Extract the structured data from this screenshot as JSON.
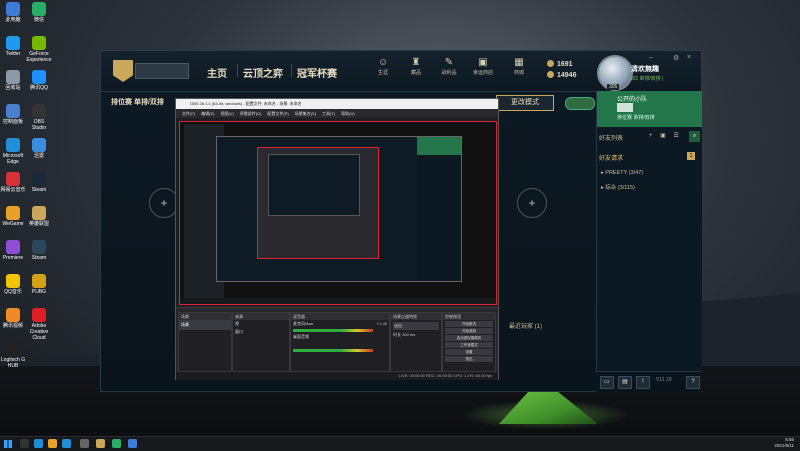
{
  "desktop": {
    "icons": [
      {
        "label": "此电脑",
        "color": "#3b7dd8"
      },
      {
        "label": "微信",
        "color": "#2aae67"
      },
      {
        "label": "Twitter",
        "color": "#1d9bf0"
      },
      {
        "label": "GeForce Experience",
        "color": "#76b900"
      },
      {
        "label": "回收站",
        "color": "#8a98a8"
      },
      {
        "label": "腾讯QQ",
        "color": "#1e90ff"
      },
      {
        "label": "控制面板",
        "color": "#4a7fd0"
      },
      {
        "label": "OBS Studio",
        "color": "#333333"
      },
      {
        "label": "Microsoft Edge",
        "color": "#1f8fd8"
      },
      {
        "label": "迅雷",
        "color": "#3a8de0"
      },
      {
        "label": "网易云音乐",
        "color": "#d8313a"
      },
      {
        "label": "Steam",
        "color": "#1b2838"
      },
      {
        "label": "WeGame",
        "color": "#e8a126"
      },
      {
        "label": "英雄联盟",
        "color": "#c9a85b"
      },
      {
        "label": "Premiere",
        "color": "#8e4fd6"
      },
      {
        "label": "Steam",
        "color": "#2a475e"
      },
      {
        "label": "QQ音乐",
        "color": "#f2c500"
      },
      {
        "label": "PUBG",
        "color": "#d4a017"
      },
      {
        "label": "腾讯视频",
        "color": "#f08a24"
      },
      {
        "label": "Adobe Creative Cloud",
        "color": "#da1f26"
      },
      {
        "label": "Logitech G HUB",
        "color": "#222222"
      }
    ]
  },
  "client": {
    "nav": {
      "home": "主页",
      "tft": "云顶之弈",
      "clash": "冠军杯赛"
    },
    "top_icons": [
      {
        "label": "生涯",
        "sym": "☺"
      },
      {
        "label": "藏品",
        "sym": "♜"
      },
      {
        "label": "战利品",
        "sym": "✎"
      },
      {
        "label": "幸运商店",
        "sym": "▣"
      },
      {
        "label": "商城",
        "sym": "▦"
      }
    ],
    "currency": {
      "be": "1691",
      "rp": "14946"
    },
    "profile": {
      "name": "清欢無趣",
      "status": "3/2 单排/双排 |",
      "level": "305"
    },
    "window_controls": {
      "minimize": "–",
      "settings": "⚙",
      "close": "×"
    },
    "mode_label": "排位赛 单排/双排",
    "edit_button": "更改模式",
    "slot_plus": "+",
    "recent_label": "最近玩家 (1)",
    "friends": {
      "party_title": "公开的小队",
      "party_status": "排位赛 单排/双排",
      "list_title": "好友列表",
      "requests": "好友请求",
      "request_count": "1",
      "groups": [
        "PREETY (3/47)",
        "综合 (3/115)"
      ],
      "version": "V11.18",
      "badge": "2"
    }
  },
  "obs": {
    "title": "OBS 26.1.1 (64-bit, windows) - 配置文件: 未命名 - 场景: 未命名",
    "menu": [
      "文件(F)",
      "编辑(E)",
      "视图(V)",
      "停靠部件(D)",
      "配置文件(P)",
      "场景集合(S)",
      "工具(T)",
      "帮助(H)"
    ],
    "docks": [
      "场景",
      "来源",
      "混音器",
      "场景过渡特效",
      "控制按钮"
    ],
    "scene": "场景",
    "sources": [
      "视",
      "窗口"
    ],
    "mixer": [
      "麦克风/Aux",
      "桌面音频"
    ],
    "transition": {
      "name": "淡出",
      "duration_label": "时长",
      "duration": "300 ms"
    },
    "controls": [
      "开始推流",
      "开始录制",
      "启动虚拟摄像机",
      "工作室模式",
      "设置",
      "退出"
    ],
    "status": "LIVE: 00:00:00   REC: 00:00:00   CPU: 1.1%, 60.00 fps",
    "volume": "0.0 dB"
  },
  "taskbar": {
    "time": "8:56",
    "date": "2021/8/11"
  }
}
